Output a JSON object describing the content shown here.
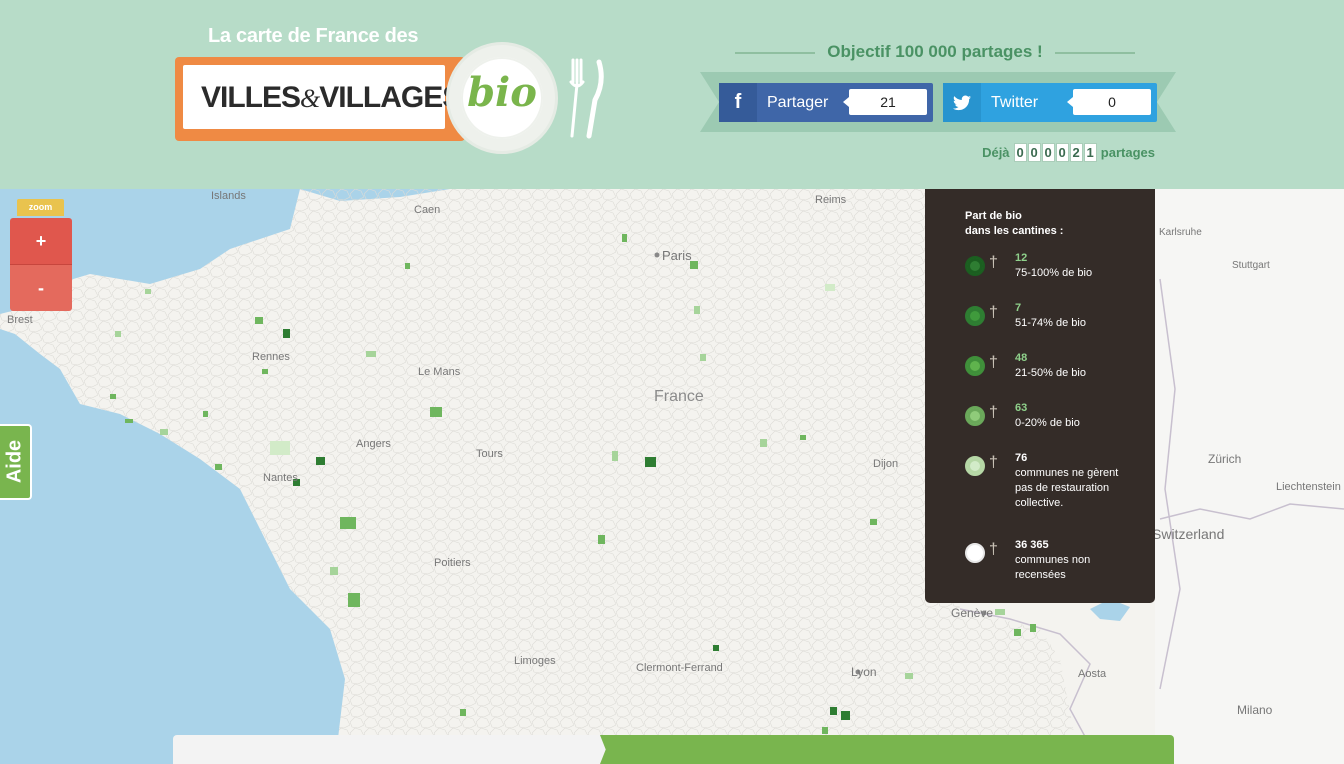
{
  "header": {
    "logo_top": "La carte de France des",
    "logo_villes": "VILLES",
    "logo_amp": "&",
    "logo_villages": "VILLAGES",
    "logo_bio": "bio",
    "objectif": "Objectif 100 000 partages !",
    "facebook": {
      "label": "Partager",
      "count": "21",
      "icon": "facebook-icon"
    },
    "twitter": {
      "label": "Twitter",
      "count": "0",
      "icon": "twitter-icon"
    },
    "deja_label": "Déjà",
    "deja_digits": [
      "0",
      "0",
      "0",
      "0",
      "2",
      "1"
    ],
    "deja_suffix": "partages"
  },
  "zoom": {
    "tab": "zoom",
    "plus": "+",
    "minus": "-"
  },
  "aide": "Aide",
  "map": {
    "places": [
      "Islands",
      "Caen",
      "Reims",
      "Paris",
      "Brest",
      "Rennes",
      "Le Mans",
      "France",
      "Angers",
      "Tours",
      "Nantes",
      "Dijon",
      "Poitiers",
      "Limoges",
      "Clermont-Ferrand",
      "Lyon",
      "Genève",
      "Karlsruhe",
      "Stuttgart",
      "Zürich",
      "Liechtenstein",
      "Switzerland",
      "Aosta",
      "Milano"
    ]
  },
  "legend": {
    "title_line1": "Part de bio",
    "title_line2": "dans les cantines :",
    "items": [
      {
        "count": "12",
        "desc": "75-100% de bio",
        "color": "#2e7d32",
        "ring": "#1b5e20",
        "count_color": "#8fd18b"
      },
      {
        "count": "7",
        "desc": "51-74% de bio",
        "color": "#3f9a3c",
        "ring": "#2e7d32",
        "count_color": "#8fd18b"
      },
      {
        "count": "48",
        "desc": "21-50% de bio",
        "color": "#5fb34d",
        "ring": "#3f8f3a",
        "count_color": "#8fd18b"
      },
      {
        "count": "63",
        "desc": "0-20% de bio",
        "color": "#8fcb7a",
        "ring": "#6aa85a",
        "count_color": "#8fd18b"
      },
      {
        "count": "76",
        "desc": "communes ne gèrent pas de restauration collective.",
        "color": "#d2ebc8",
        "ring": "#b5d7a5",
        "count_color": "#ffffff"
      },
      {
        "count": "36 365",
        "desc": "communes non recensées",
        "color": "#ffffff",
        "ring": "#e8e8e8",
        "count_color": "#ffffff"
      }
    ]
  },
  "colors": {
    "header_bg": "#b7dcc8",
    "accent_green": "#79b54e",
    "zoom_red": "#e0574d",
    "legend_bg": "#342c28",
    "facebook": "#3f66a8",
    "twitter": "#2fa2e0"
  }
}
